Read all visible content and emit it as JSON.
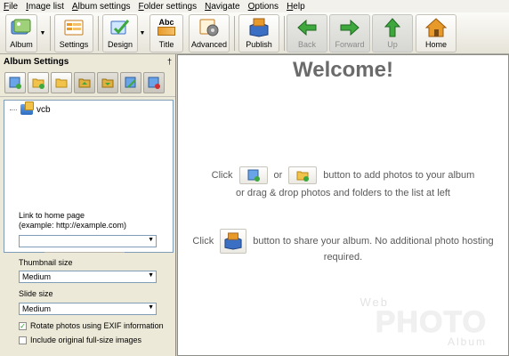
{
  "menu": [
    {
      "label": "File",
      "acc": "F",
      "rest": "ile"
    },
    {
      "label": "Image list",
      "acc": "I",
      "rest": "mage list"
    },
    {
      "label": "Album settings",
      "acc": "A",
      "rest": "lbum settings"
    },
    {
      "label": "Folder settings",
      "acc": "F",
      "rest": "older settings"
    },
    {
      "label": "Navigate",
      "acc": "N",
      "rest": "avigate"
    },
    {
      "label": "Options",
      "acc": "O",
      "rest": "ptions"
    },
    {
      "label": "Help",
      "acc": "H",
      "rest": "elp"
    }
  ],
  "toolbar": {
    "album": "Album",
    "settings": "Settings",
    "design": "Design",
    "title": "Title",
    "title_icon_text": "Abc",
    "advanced": "Advanced",
    "publish": "Publish",
    "back": "Back",
    "forward": "Forward",
    "up": "Up",
    "home": "Home"
  },
  "left_panel": {
    "title": "Album Settings",
    "pin_glyph": "†",
    "tree_item": "vcb",
    "link_label": "Link to home page",
    "link_example": "(example: http://example.com)",
    "link_value": "",
    "thumb_label": "Thumbnail size",
    "thumb_value": "Medium",
    "slide_label": "Slide size",
    "slide_value": "Medium",
    "rotate_label": "Rotate photos using EXIF information",
    "rotate_checked": true,
    "include_label": "Include original full-size images",
    "include_checked": false
  },
  "main": {
    "welcome": "Welcome!",
    "click1": "Click",
    "or": "or",
    "add_text": "button to add photos to your album",
    "drag_text": "or drag & drop photos and folders to the list at left",
    "click2": "Click",
    "share_text": "button to share your album. No additional photo hosting",
    "required": "required.",
    "watermark_web": "Web",
    "watermark_photo": "PHOTO",
    "watermark_album": "Album"
  },
  "colors": {
    "accent_green": "#3ea83e",
    "folder_yellow": "#f2c34a",
    "home_orange": "#e79a2a",
    "publish_blue": "#3a6fc4"
  }
}
